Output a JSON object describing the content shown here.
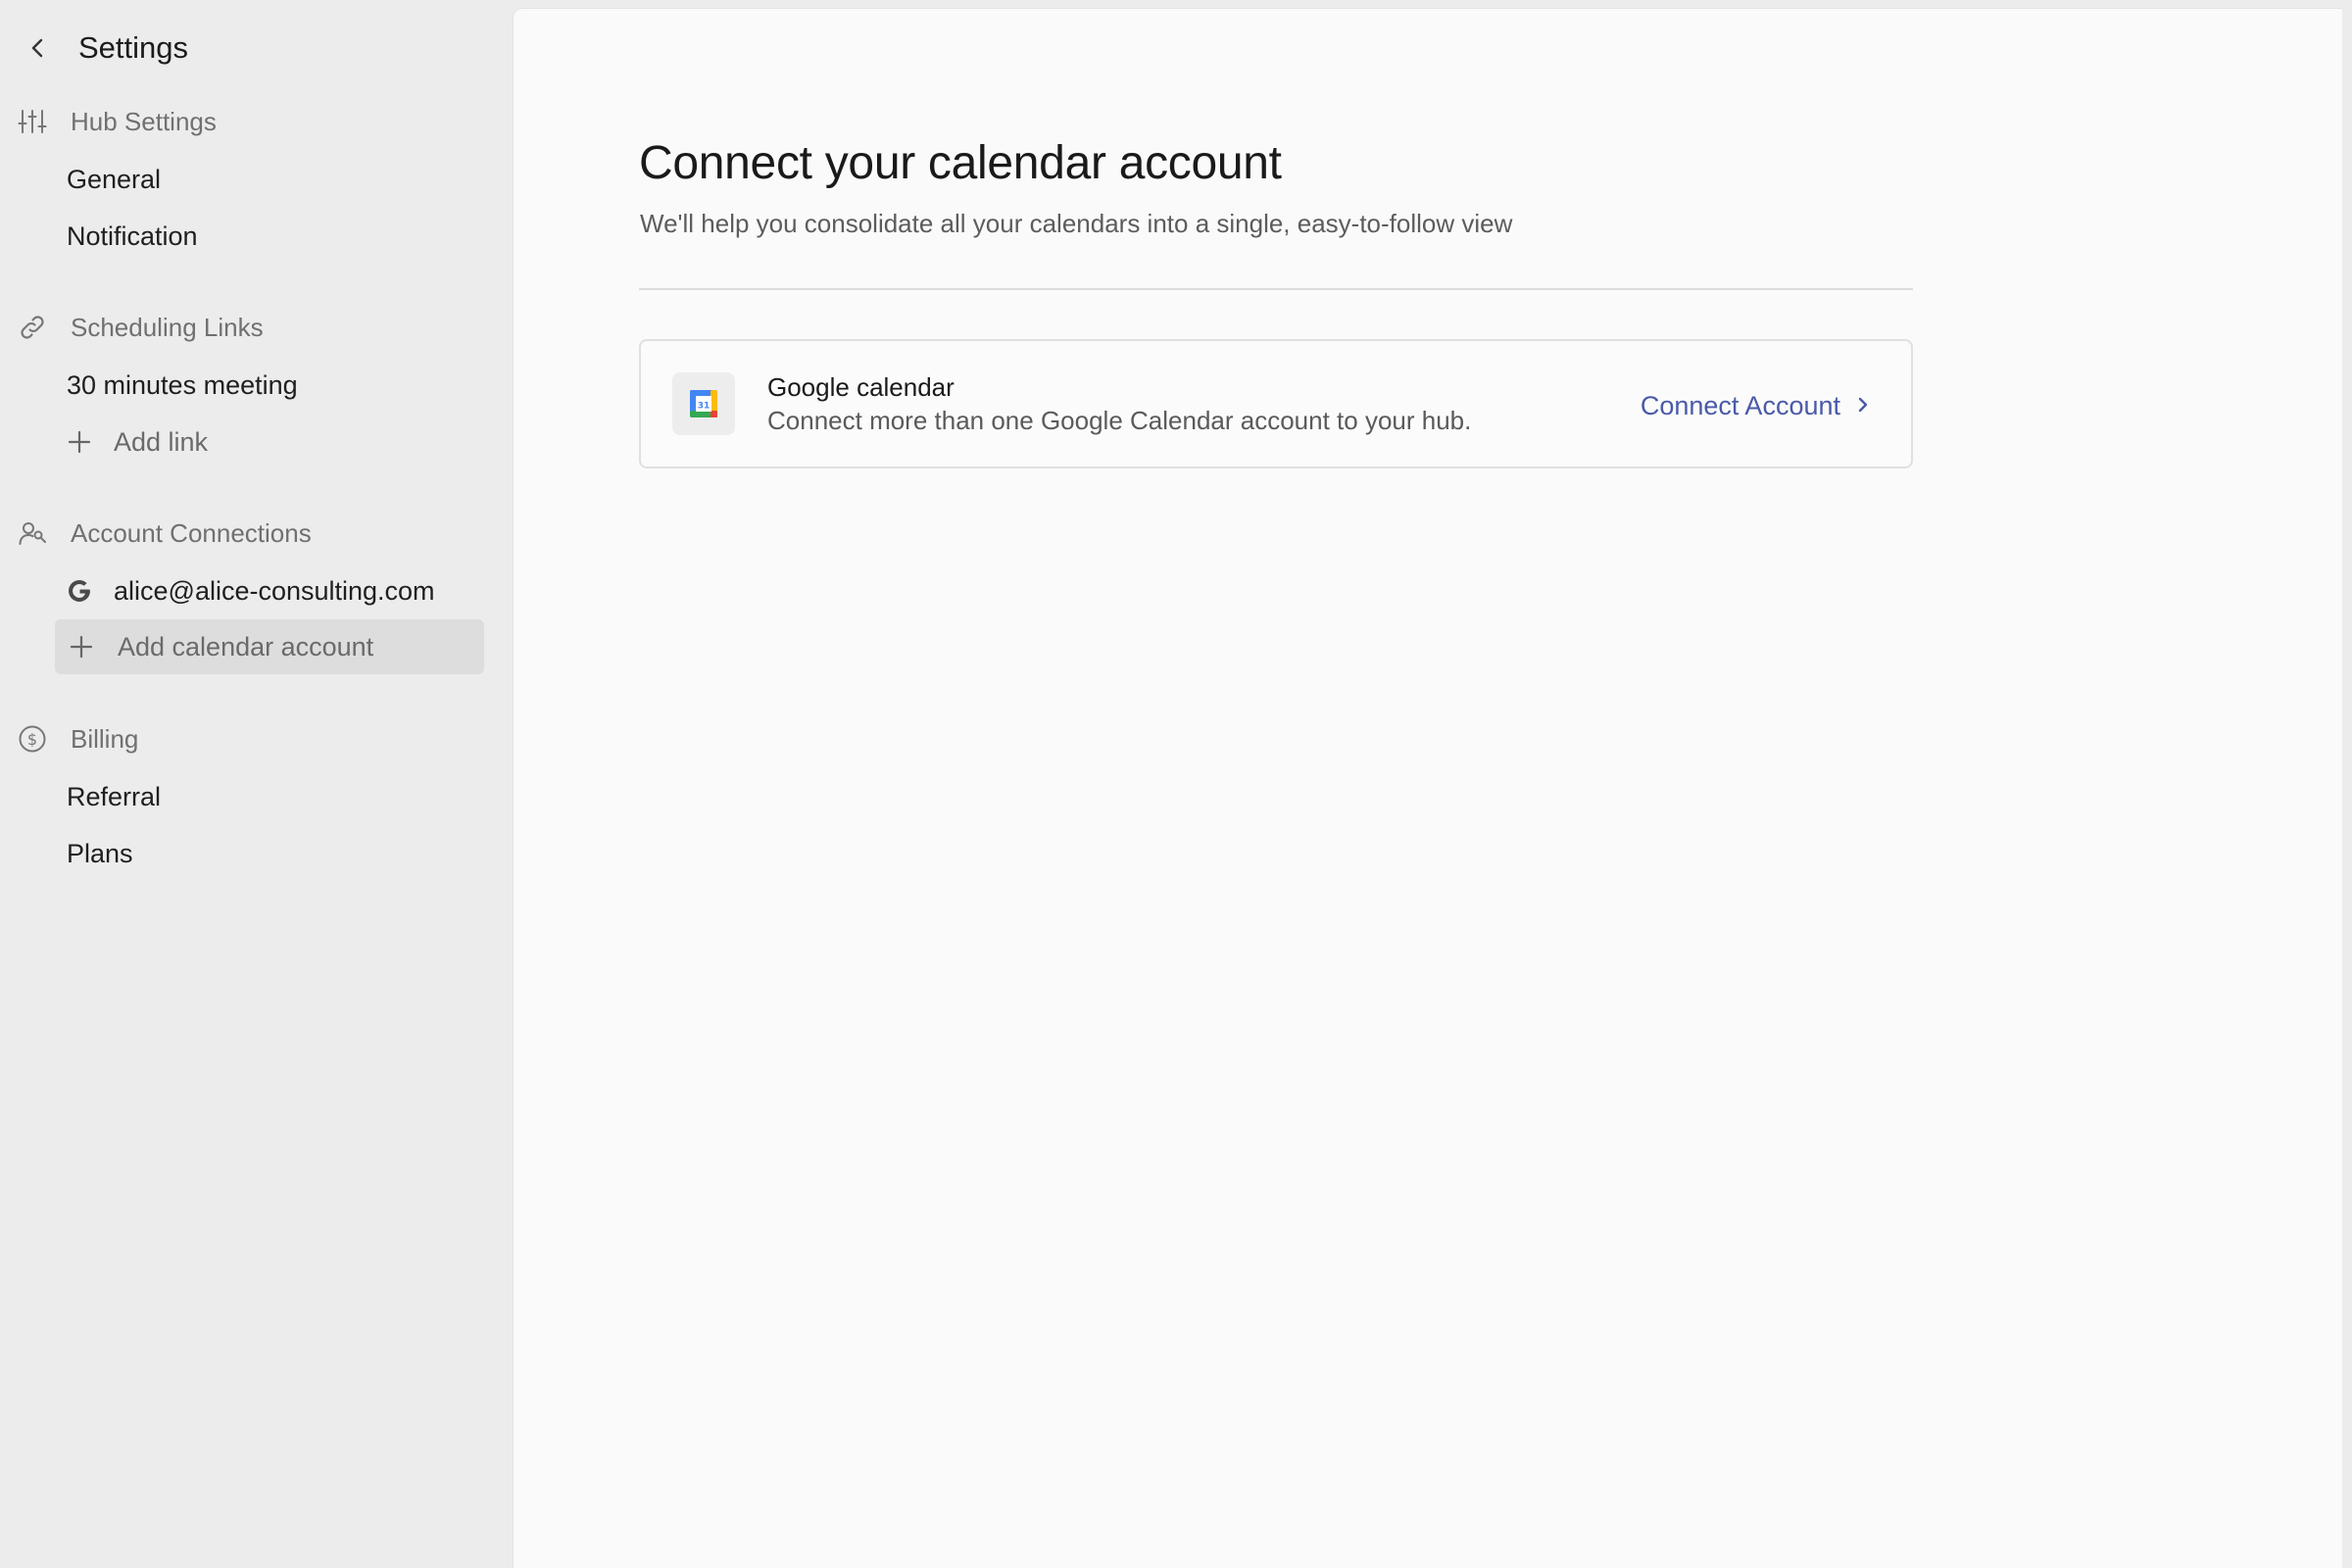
{
  "sidebar": {
    "title": "Settings",
    "sections": {
      "hub": {
        "label": "Hub Settings",
        "icon": "sliders-icon",
        "items": [
          "General",
          "Notification"
        ]
      },
      "scheduling": {
        "label": "Scheduling Links",
        "icon": "link-icon",
        "items": [
          "30 minutes meeting"
        ],
        "add_label": "Add link"
      },
      "accounts": {
        "label": "Account Connections",
        "icon": "users-icon",
        "connected_account": "alice@alice-consulting.com",
        "connected_icon": "google-g-icon",
        "add_label": "Add calendar account"
      },
      "billing": {
        "label": "Billing",
        "icon": "dollar-circle-icon",
        "items": [
          "Referral",
          "Plans"
        ]
      }
    }
  },
  "main": {
    "title": "Connect your calendar account",
    "subtitle": "We'll help you consolidate all your calendars into a single, easy-to-follow view",
    "card": {
      "icon": "google-calendar-icon",
      "icon_text": "31",
      "title": "Google calendar",
      "description": "Connect more than one Google Calendar account to your hub.",
      "action_label": "Connect Account"
    }
  },
  "colors": {
    "accent": "#4a5aa8",
    "sidebar_bg": "#ececec",
    "main_bg": "#fafafa",
    "selected_bg": "#dddddd"
  }
}
